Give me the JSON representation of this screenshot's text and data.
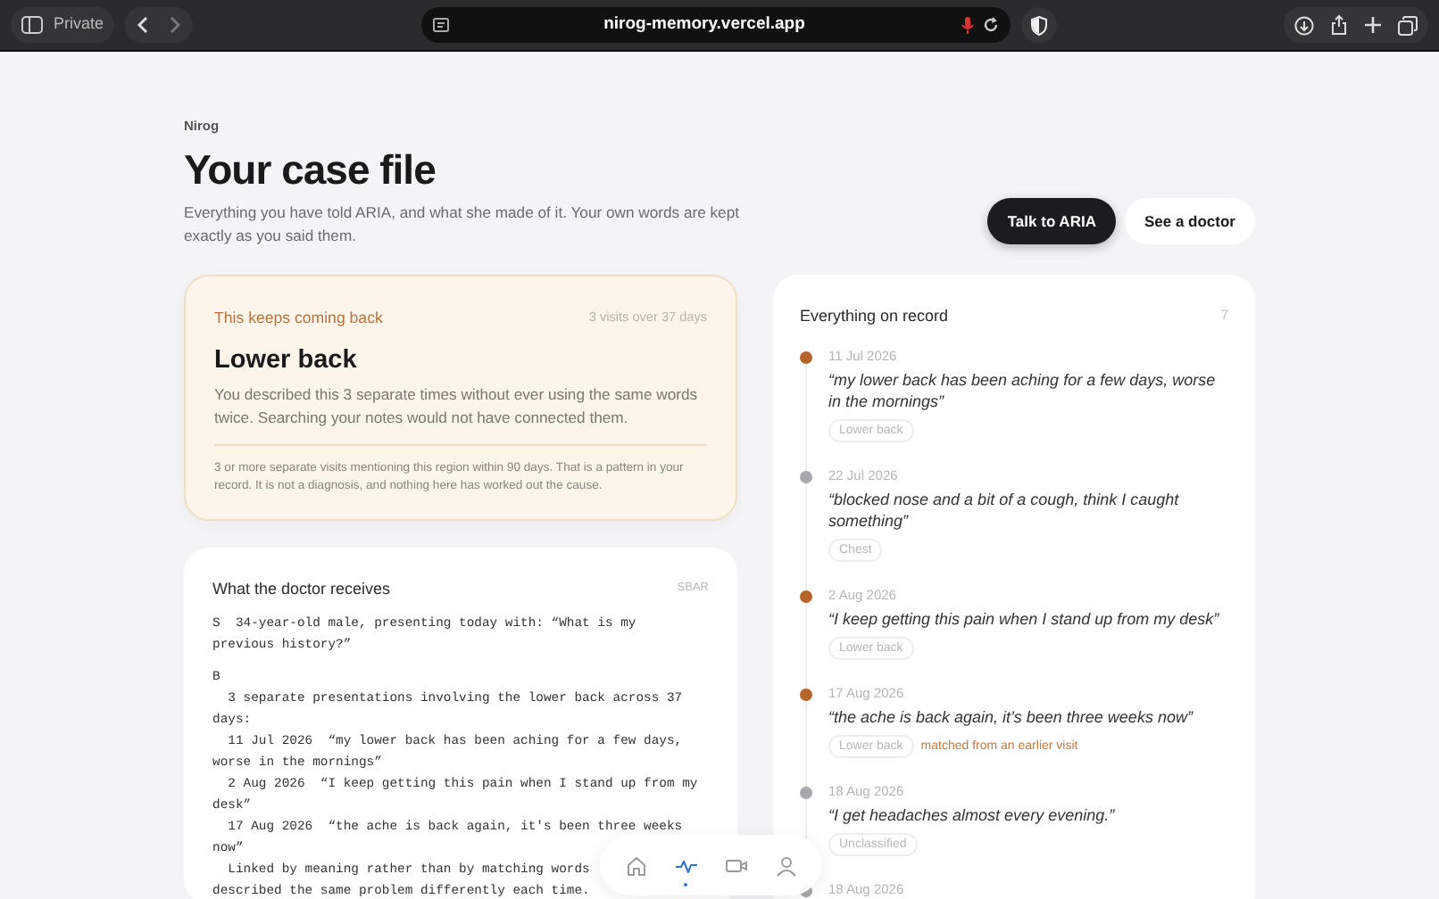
{
  "browser": {
    "private_label": "Private",
    "url": "nirog-memory.vercel.app"
  },
  "brand": "Nirog",
  "title": "Your case file",
  "subtitle": "Everything you have told ARIA, and what she made of it. Your own words are kept exactly as you said them.",
  "actions": [
    {
      "label": "Talk to ARIA",
      "kind": "primary"
    },
    {
      "label": "See a doctor",
      "kind": "secondary"
    }
  ],
  "pattern_card": {
    "eyebrow": "This keeps coming back",
    "meta": "3 visits over 37 days",
    "heading": "Lower back",
    "body": "You described this 3 separate times without ever using the same words twice. Searching your notes would not have connected them.",
    "footnote": "3 or more separate visits mentioning this region within 90 days. That is a pattern in your record. It is not a diagnosis, and nothing here has worked out the cause."
  },
  "doctor_card": {
    "title": "What the doctor receives",
    "badge": "SBAR",
    "sections": [
      {
        "lines": [
          "S  34-year-old male, presenting today with: “What is my",
          "previous history?”"
        ]
      },
      {
        "lines": [
          "B",
          "  3 separate presentations involving the lower back across 37",
          "days:",
          "  11 Jul 2026  “my lower back has been aching for a few days,",
          "worse in the mornings”",
          "  2 Aug 2026  “I keep getting this pain when I stand up from my",
          "desk”",
          "  17 Aug 2026  “the ache is back again, it's been three weeks",
          "now”",
          "  Linked by meaning rather than by matching words",
          "described the same problem differently each time."
        ]
      }
    ]
  },
  "record": {
    "title": "Everything on record",
    "count": "7",
    "entries": [
      {
        "date": "11 Jul 2026",
        "quote": "“my lower back has been aching for a few days, worse in the mornings”",
        "tag": "Lower back",
        "color": "#b5652c"
      },
      {
        "date": "22 Jul 2026",
        "quote": "“blocked nose and a bit of a cough, think I caught something”",
        "tag": "Chest",
        "color": "#a8a8ac"
      },
      {
        "date": "2 Aug 2026",
        "quote": "“I keep getting this pain when I stand up from my desk”",
        "tag": "Lower back",
        "color": "#b5652c"
      },
      {
        "date": "17 Aug 2026",
        "quote": "“the ache is back again, it’s been three weeks now”",
        "tag": "Lower back",
        "note": "matched from an earlier visit",
        "color": "#b5652c"
      },
      {
        "date": "18 Aug 2026",
        "quote": "“I get headaches almost every evening.”",
        "tag": "Unclassified",
        "color": "#a8a8ac"
      },
      {
        "date": "18 Aug 2026",
        "color": "#a8a8ac"
      }
    ]
  },
  "nav": [
    {
      "selected": false
    },
    {
      "selected": true
    },
    {
      "selected": false
    },
    {
      "selected": false
    }
  ]
}
